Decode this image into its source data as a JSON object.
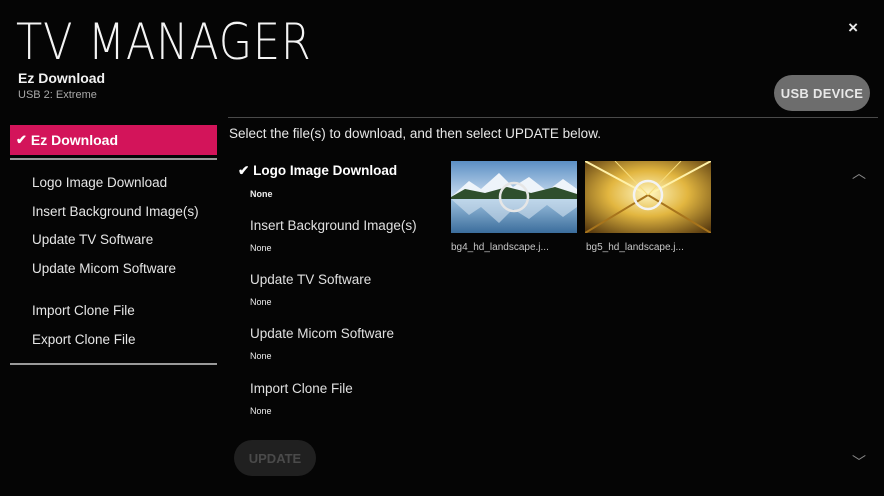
{
  "app": {
    "title": "TV MANAGER",
    "subtitle": "Ez Download",
    "device": "USB 2: Extreme",
    "close_label": "×",
    "usb_device_label": "USB DEVICE"
  },
  "sidebar": {
    "active": {
      "label": "Ez Download",
      "check": "✔"
    },
    "items": [
      {
        "label": "Logo Image Download"
      },
      {
        "label": "Insert Background Image(s)"
      },
      {
        "label": "Update TV Software"
      },
      {
        "label": "Update Micom Software"
      },
      {
        "label": "Import Clone File"
      },
      {
        "label": "Export Clone File"
      }
    ]
  },
  "main": {
    "instruction": "Select the file(s) to download, and then select UPDATE below.",
    "selected_check": "✔",
    "options": [
      {
        "label": "Logo Image Download",
        "value": "None"
      },
      {
        "label": "Insert Background Image(s)",
        "value": "None"
      },
      {
        "label": "Update TV Software",
        "value": "None"
      },
      {
        "label": "Update Micom Software",
        "value": "None"
      },
      {
        "label": "Import Clone File",
        "value": "None"
      }
    ],
    "files": [
      {
        "name": "bg4_hd_landscape.j..."
      },
      {
        "name": "bg5_hd_landscape.j..."
      }
    ],
    "update_label": "UPDATE",
    "scroll_up": "︿",
    "scroll_down": "﹀"
  },
  "colors": {
    "accent": "#d3145a",
    "background": "#050505",
    "button_gray": "#6d6d6d"
  },
  "icons": [
    "close-icon",
    "check-icon",
    "magnifier-icon",
    "chevron-up-icon",
    "chevron-down-icon"
  ]
}
